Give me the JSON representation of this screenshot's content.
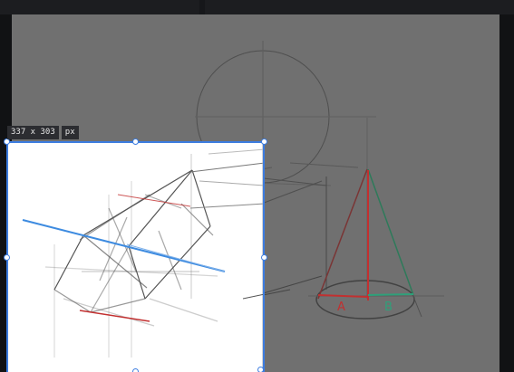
{
  "crop_tool": {
    "size_text": "337 x 303",
    "unit_text": "px",
    "accent_color": "#3d7de0"
  },
  "canvas": {
    "background": "#707070",
    "sketch_labels": {
      "label_a": "A",
      "label_b": "B"
    }
  }
}
